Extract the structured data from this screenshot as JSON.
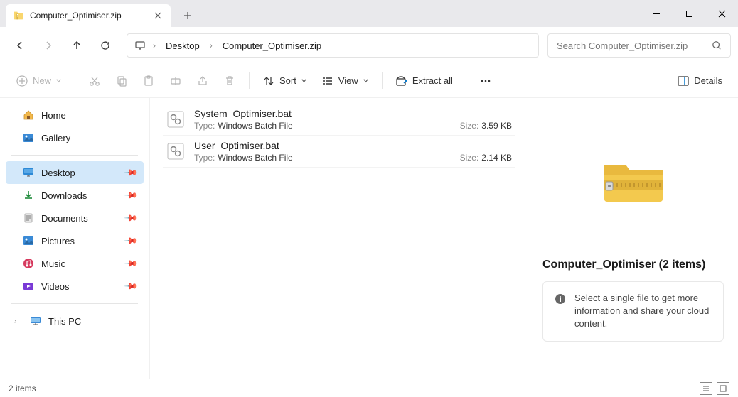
{
  "window": {
    "tab_title": "Computer_Optimiser.zip"
  },
  "breadcrumb": [
    "Desktop",
    "Computer_Optimiser.zip"
  ],
  "search": {
    "placeholder": "Search Computer_Optimiser.zip"
  },
  "toolbar": {
    "new": "New",
    "sort": "Sort",
    "view": "View",
    "extract_all": "Extract all",
    "details": "Details"
  },
  "sidebar": {
    "home": "Home",
    "gallery": "Gallery",
    "pinned": [
      {
        "label": "Desktop",
        "selected": true
      },
      {
        "label": "Downloads"
      },
      {
        "label": "Documents"
      },
      {
        "label": "Pictures"
      },
      {
        "label": "Music"
      },
      {
        "label": "Videos"
      }
    ],
    "thispc": "This PC"
  },
  "files": [
    {
      "name": "System_Optimiser.bat",
      "type_label": "Type:",
      "type": "Windows Batch File",
      "size_label": "Size:",
      "size": "3.59 KB"
    },
    {
      "name": "User_Optimiser.bat",
      "type_label": "Type:",
      "type": "Windows Batch File",
      "size_label": "Size:",
      "size": "2.14 KB"
    }
  ],
  "details": {
    "heading": "Computer_Optimiser (2 items)",
    "tip": "Select a single file to get more information and share your cloud content."
  },
  "status": {
    "text": "2 items"
  }
}
